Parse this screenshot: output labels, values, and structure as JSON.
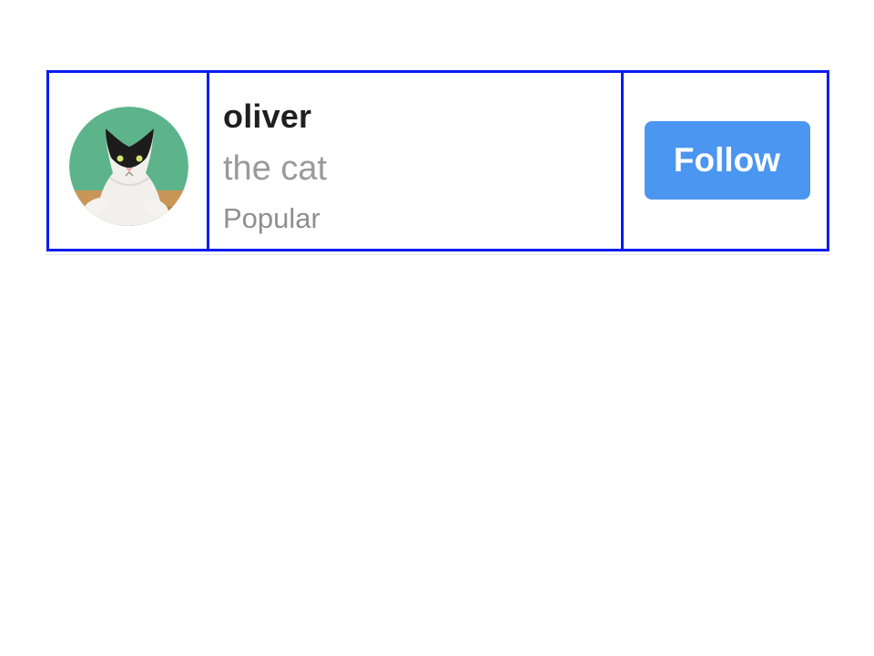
{
  "profile": {
    "name": "oliver",
    "subtitle": "the cat",
    "tag": "Popular",
    "avatar_icon": "cat-photo-avatar"
  },
  "actions": {
    "follow_label": "Follow"
  },
  "colors": {
    "border": "#0a1cf0",
    "button_bg": "#4a96f1",
    "button_text": "#ffffff",
    "name_text": "#1f1f1f",
    "subtitle_text": "#9a9a9a"
  }
}
